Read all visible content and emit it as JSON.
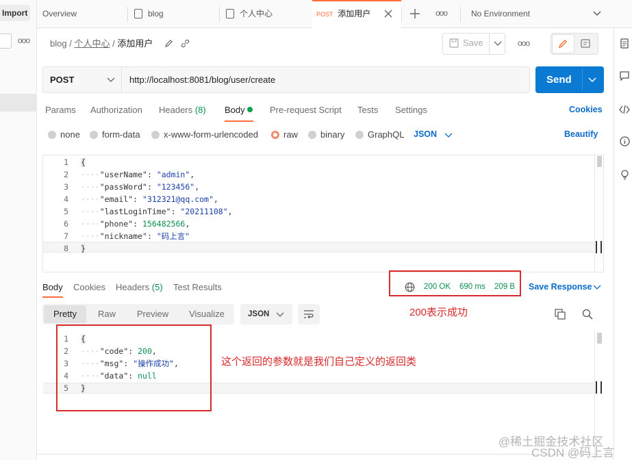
{
  "sidebar": {
    "import_label": "Import",
    "more": "ooo"
  },
  "tabs": [
    {
      "label": "Overview"
    },
    {
      "label": "blog"
    },
    {
      "label": "个人中心"
    },
    {
      "method": "POST",
      "label": "添加用户"
    }
  ],
  "environment": {
    "label": "No Environment"
  },
  "breadcrumb": {
    "root": "blog",
    "sep": "/",
    "folder": "个人中心",
    "current": "添加用户"
  },
  "toolbar": {
    "save_label": "Save",
    "more": "ooo"
  },
  "request": {
    "method": "POST",
    "url": "http://localhost:8081/blog/user/create",
    "send_label": "Send"
  },
  "request_tabs": [
    "Params",
    "Authorization",
    "Headers",
    "Body",
    "Pre-request Script",
    "Tests",
    "Settings"
  ],
  "headers_count": "(8)",
  "cookies_label": "Cookies",
  "body_options": [
    "none",
    "form-data",
    "x-www-form-urlencoded",
    "raw",
    "binary",
    "GraphQL"
  ],
  "body_format": "JSON",
  "beautify_label": "Beautify",
  "request_body": {
    "lines": [
      {
        "n": "1",
        "text": "{"
      },
      {
        "n": "2",
        "key": "\"userName\"",
        "val": "\"admin\"",
        "end": ","
      },
      {
        "n": "3",
        "key": "\"passWord\"",
        "val": "\"123456\"",
        "end": ","
      },
      {
        "n": "4",
        "key": "\"email\"",
        "val": "\"312321@qq.com\"",
        "end": ","
      },
      {
        "n": "5",
        "key": "\"lastLoginTime\"",
        "val": "\"20211108\"",
        "end": ","
      },
      {
        "n": "6",
        "key": "\"phone\"",
        "val": "156482566",
        "end": ","
      },
      {
        "n": "7",
        "key": "\"nickname\"",
        "val": "\"码上言\"",
        "end": ""
      },
      {
        "n": "8",
        "text": "}"
      }
    ]
  },
  "response_tabs": [
    "Body",
    "Cookies",
    "Headers",
    "Test Results"
  ],
  "response_headers_count": "(5)",
  "status": {
    "code": "200 OK",
    "time": "690 ms",
    "size": "209 B"
  },
  "save_response_label": "Save Response",
  "view_modes": [
    "Pretty",
    "Raw",
    "Preview",
    "Visualize"
  ],
  "response_format": "JSON",
  "response_body": {
    "lines": [
      {
        "n": "1",
        "text": "{"
      },
      {
        "n": "2",
        "key": "\"code\"",
        "val": "200",
        "end": ","
      },
      {
        "n": "3",
        "key": "\"msg\"",
        "val": "\"操作成功\"",
        "end": ","
      },
      {
        "n": "4",
        "key": "\"data\"",
        "val": "null",
        "end": ""
      },
      {
        "n": "5",
        "text": "}"
      }
    ]
  },
  "annotations": {
    "status_note": "200表示成功",
    "body_note": "这个返回的参数就是我们自己定义的返回类"
  },
  "watermark": {
    "line1": "@稀土掘金技术社区",
    "line2": "CSDN @码上言"
  },
  "colors": {
    "accent": "#ff6c37",
    "send": "#0b7ad3",
    "status_ok": "#0b8f4f",
    "link": "#0b6bcb",
    "annotation": "#d9292b"
  }
}
